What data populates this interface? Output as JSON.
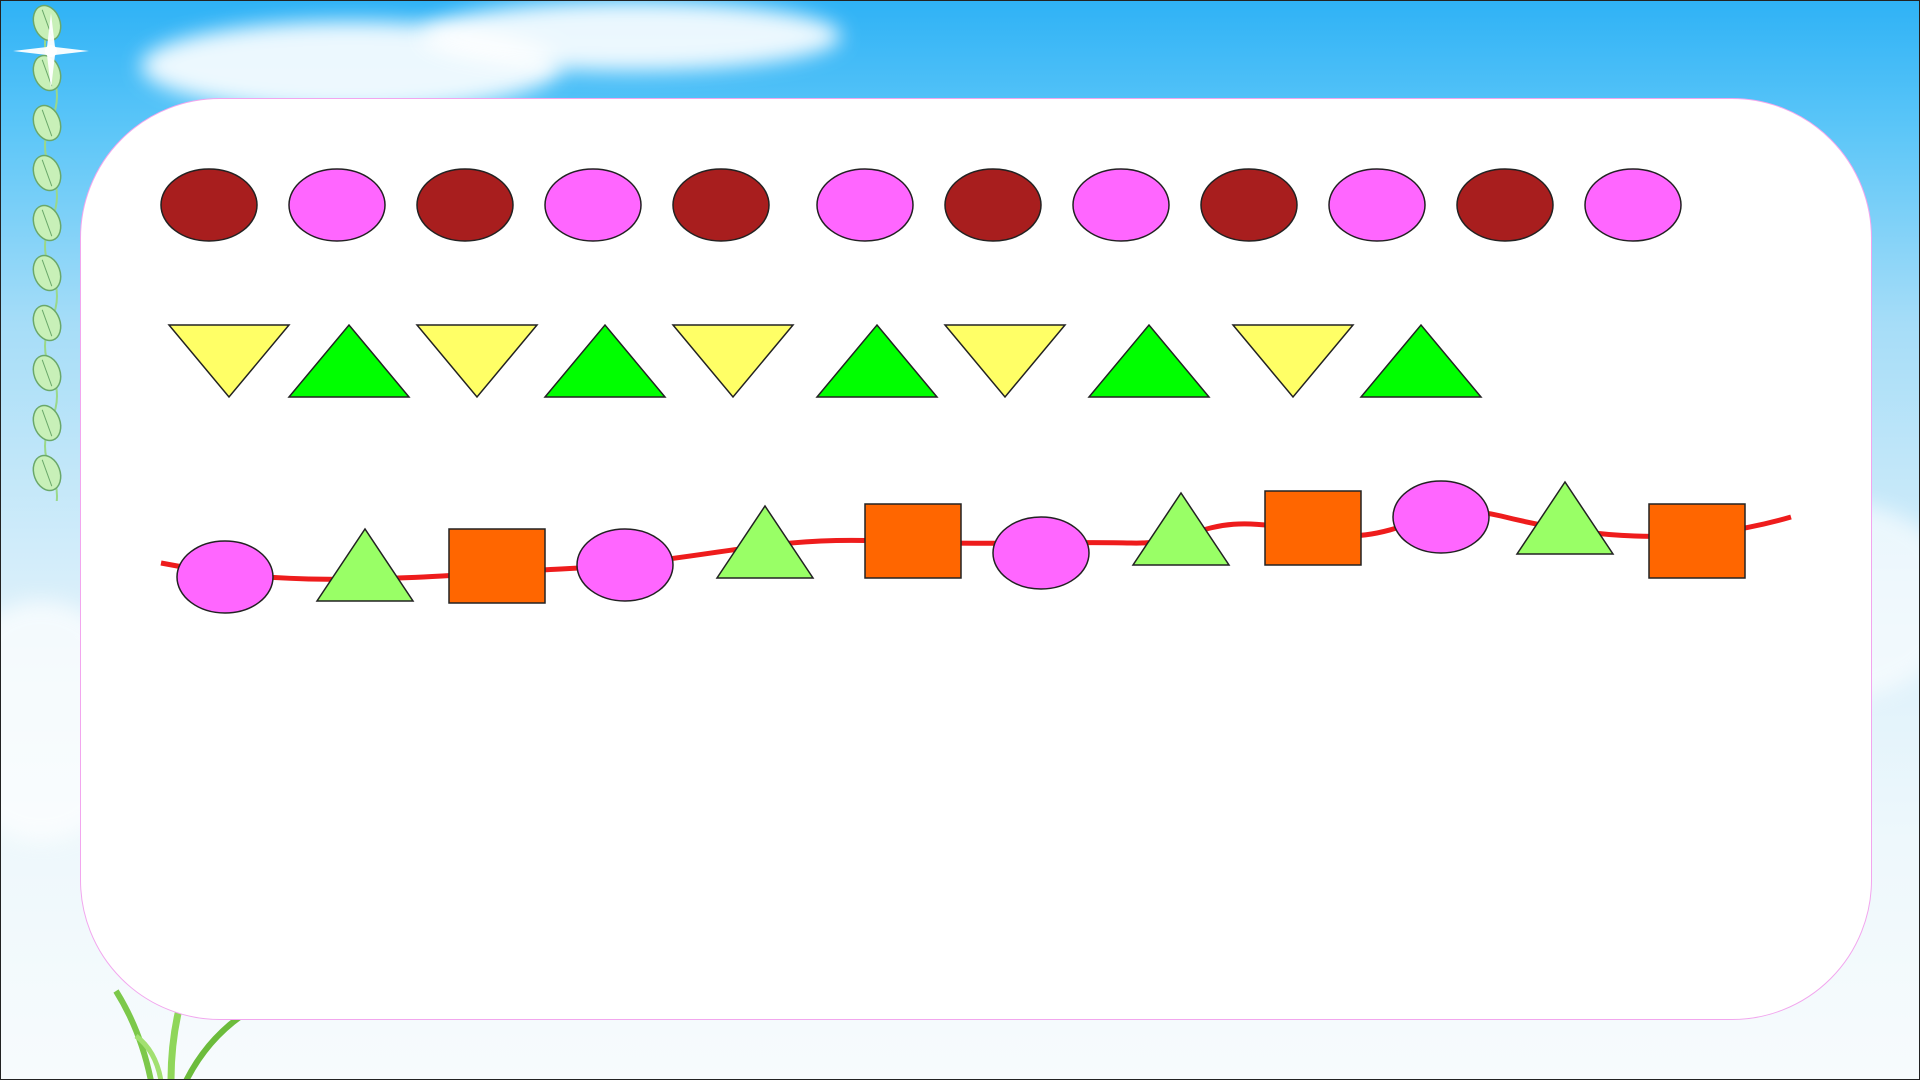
{
  "slide": {
    "background_top": "#2fb2f6",
    "background_bottom": "#f7fbfd",
    "card_color": "#ffffff",
    "card_border": "#f2a6ee"
  },
  "rows": [
    {
      "name": "ellipse-pattern-row",
      "pattern": [
        "dark-red-ellipse",
        "pink-ellipse"
      ],
      "shapes": [
        "ellipse",
        "ellipse",
        "ellipse",
        "ellipse",
        "ellipse",
        "ellipse",
        "ellipse",
        "ellipse",
        "ellipse",
        "ellipse",
        "ellipse",
        "ellipse"
      ],
      "colors": [
        "#a81e1e",
        "#ff66ff",
        "#a81e1e",
        "#ff66ff",
        "#a81e1e",
        "#ff66ff",
        "#a81e1e",
        "#ff66ff",
        "#a81e1e",
        "#ff66ff",
        "#a81e1e",
        "#ff66ff"
      ]
    },
    {
      "name": "triangle-pattern-row",
      "pattern": [
        "yellow-down-triangle",
        "green-up-triangle"
      ],
      "shapes": [
        "triangle-down",
        "triangle-up",
        "triangle-down",
        "triangle-up",
        "triangle-down",
        "triangle-up",
        "triangle-down",
        "triangle-up",
        "triangle-down",
        "triangle-up"
      ],
      "colors": [
        "#ffff66",
        "#00ff00",
        "#ffff66",
        "#00ff00",
        "#ffff66",
        "#00ff00",
        "#ffff66",
        "#00ff00",
        "#ffff66",
        "#00ff00"
      ]
    },
    {
      "name": "string-of-beads-row",
      "pattern": [
        "pink-ellipse",
        "light-green-triangle",
        "orange-square"
      ],
      "shapes": [
        "ellipse",
        "triangle-up",
        "square",
        "ellipse",
        "triangle-up",
        "square",
        "ellipse",
        "triangle-up",
        "square",
        "ellipse",
        "triangle-up",
        "square"
      ],
      "colors": [
        "#ff66ff",
        "#99ff66",
        "#ff6600",
        "#ff66ff",
        "#99ff66",
        "#ff6600",
        "#ff66ff",
        "#99ff66",
        "#ff6600",
        "#ff66ff",
        "#99ff66",
        "#ff6600"
      ],
      "string_color": "#ee1c1c"
    }
  ],
  "decorations": {
    "vine_leaf_count": 10,
    "leaf_color": "#c8f0b8",
    "icons": [
      "leaf-vine-icon",
      "sparkle-icon",
      "grass-icon",
      "cloud-icon"
    ]
  }
}
